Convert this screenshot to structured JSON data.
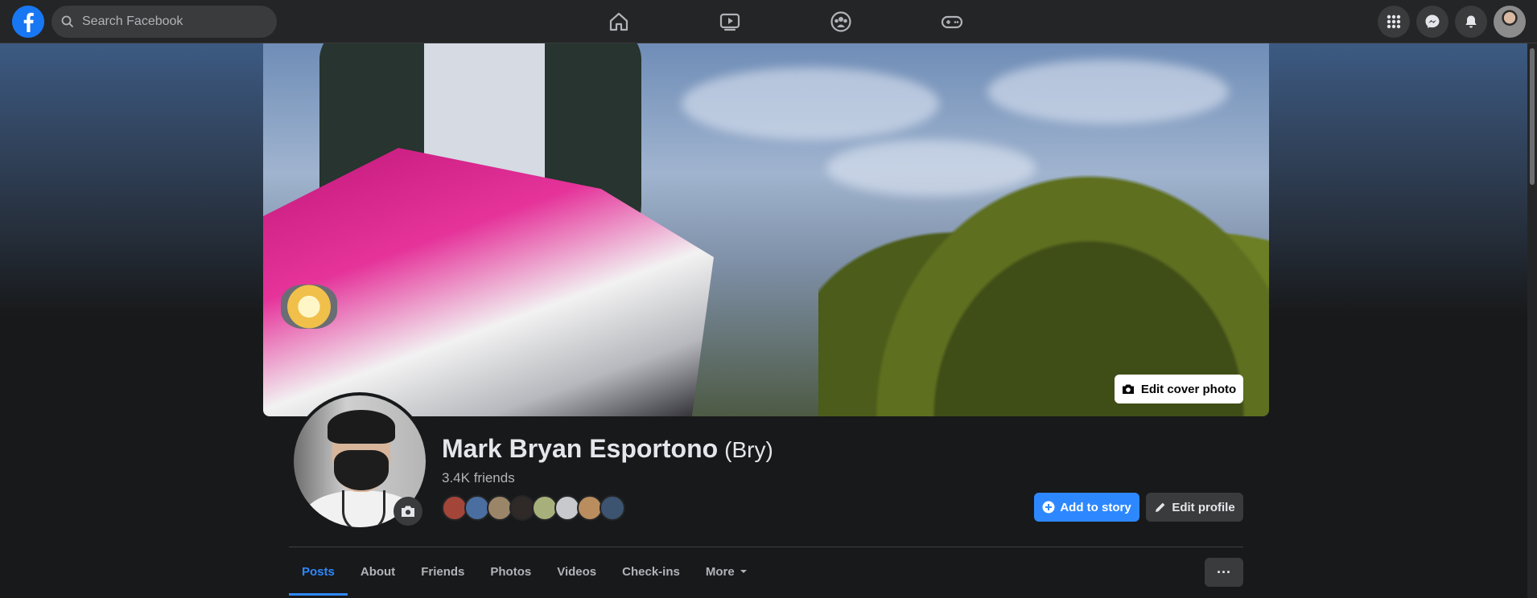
{
  "search": {
    "placeholder": "Search Facebook"
  },
  "nav": {
    "center_icons": [
      "home-icon",
      "watch-icon",
      "groups-icon",
      "gaming-icon"
    ],
    "right_icons": [
      "menu-grid-icon",
      "messenger-icon",
      "notifications-icon",
      "account-avatar"
    ]
  },
  "cover": {
    "edit_label": "Edit cover photo"
  },
  "profile": {
    "name": "Mark Bryan Esportono",
    "nickname": "(Bry)",
    "friends_count": "3.4K friends",
    "friend_thumbnails": 8
  },
  "actions": {
    "add_story": "Add to story",
    "edit_profile": "Edit profile"
  },
  "tabs": [
    {
      "label": "Posts",
      "active": true
    },
    {
      "label": "About"
    },
    {
      "label": "Friends"
    },
    {
      "label": "Photos"
    },
    {
      "label": "Videos"
    },
    {
      "label": "Check-ins"
    },
    {
      "label": "More"
    }
  ],
  "more_menu": {
    "label": "···"
  },
  "colors": {
    "accent": "#2d88ff",
    "brand": "#1877f2",
    "bg": "#18191a",
    "surface": "#242526"
  }
}
